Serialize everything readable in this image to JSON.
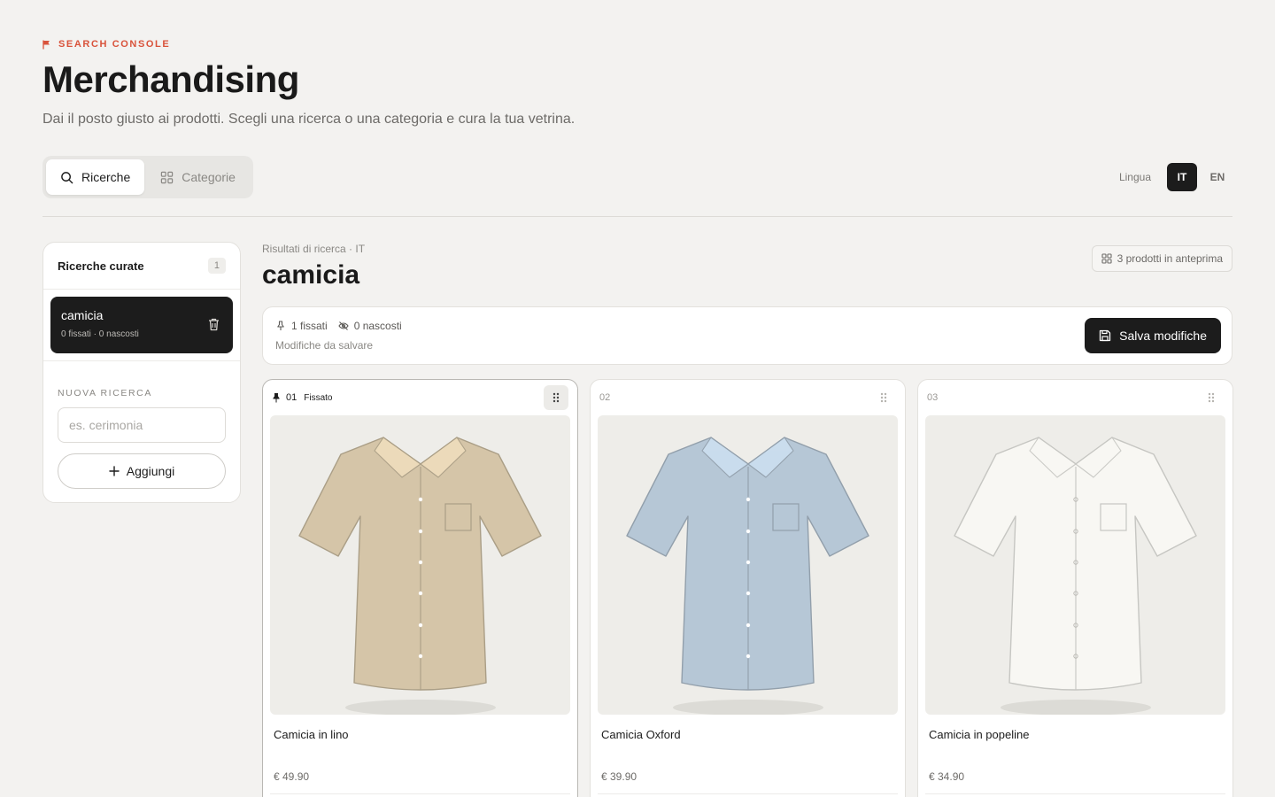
{
  "header": {
    "eyebrow": "SEARCH CONSOLE",
    "title": "Merchandising",
    "subtitle": "Dai il posto giusto ai prodotti. Scegli una ricerca o una categoria e cura la tua vetrina."
  },
  "tabs": [
    {
      "label": "Ricerche",
      "active": true
    },
    {
      "label": "Categorie",
      "active": false
    }
  ],
  "language": {
    "label": "Lingua",
    "options": [
      "IT",
      "EN"
    ],
    "selected": "IT"
  },
  "sidebar": {
    "title": "Ricerche curate",
    "count": "1",
    "items": [
      {
        "name": "camicia",
        "meta": "0 fissati · 0 nascosti"
      }
    ],
    "new_label": "NUOVA RICERCA",
    "input_placeholder": "es. cerimonia",
    "add_label": "Aggiungi"
  },
  "main": {
    "eyebrow": "Risultati di ricerca · IT",
    "title": "camicia",
    "preview_badge": "3 prodotti in anteprima",
    "status": {
      "pinned": "1 fissati",
      "hidden": "0 nascosti",
      "note": "Modifiche da salvare",
      "save_label": "Salva modifiche"
    },
    "products": [
      {
        "position": "01",
        "pin_label": "Fissato",
        "name": "Camicia in lino",
        "price": "€ 49.90",
        "color": "#d5c5a8",
        "pinned": true
      },
      {
        "position": "02",
        "pin_label": "",
        "name": "Camicia Oxford",
        "price": "€ 39.90",
        "color": "#b6c7d6",
        "pinned": false
      },
      {
        "position": "03",
        "pin_label": "",
        "name": "Camicia in popeline",
        "price": "€ 34.90",
        "color": "#f8f7f3",
        "pinned": false
      }
    ]
  },
  "colors": {
    "accent": "#d9533b",
    "dark": "#1c1c1c",
    "background": "#f3f2f0"
  }
}
